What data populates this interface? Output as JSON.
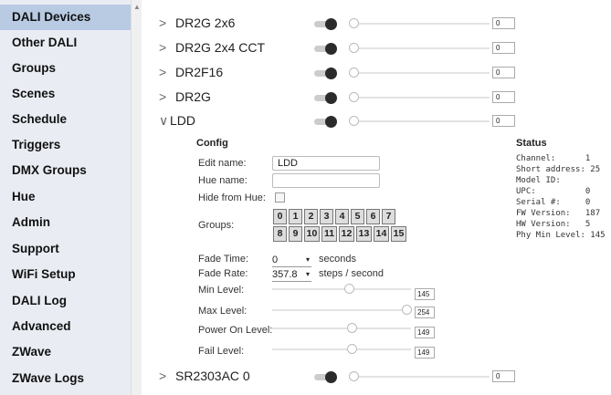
{
  "sidebar": {
    "items": [
      {
        "label": "DALI Devices",
        "active": true
      },
      {
        "label": "Other DALI"
      },
      {
        "label": "Groups"
      },
      {
        "label": "Scenes"
      },
      {
        "label": "Schedule"
      },
      {
        "label": "Triggers"
      },
      {
        "label": "DMX Groups"
      },
      {
        "label": "Hue"
      },
      {
        "label": "Admin"
      },
      {
        "label": "Support"
      },
      {
        "label": "WiFi Setup"
      },
      {
        "label": "DALI Log"
      },
      {
        "label": "Advanced"
      },
      {
        "label": "ZWave"
      },
      {
        "label": "ZWave Logs"
      }
    ]
  },
  "devices": [
    {
      "chevron": ">",
      "name": "DR2G 2x6",
      "value": "0"
    },
    {
      "chevron": ">",
      "name": "DR2G 2x4 CCT",
      "value": "0"
    },
    {
      "chevron": ">",
      "name": "DR2F16",
      "value": "0"
    },
    {
      "chevron": ">",
      "name": "DR2G",
      "value": "0"
    },
    {
      "chevron": "∨",
      "name": "LDD",
      "value": "0"
    },
    {
      "chevron": ">",
      "name": "SR2303AC 0",
      "value": "0"
    }
  ],
  "config": {
    "title": "Config",
    "edit_name_label": "Edit name:",
    "edit_name_value": "LDD",
    "hue_name_label": "Hue name:",
    "hue_name_value": "",
    "hide_from_hue_label": "Hide from Hue:",
    "groups_label": "Groups:",
    "groups_row1": [
      "0",
      "1",
      "2",
      "3",
      "4",
      "5",
      "6",
      "7"
    ],
    "groups_row2": [
      "8",
      "9",
      "10",
      "11",
      "12",
      "13",
      "14",
      "15"
    ],
    "fade_time_label": "Fade Time:",
    "fade_time_value": "0",
    "fade_time_unit": "seconds",
    "fade_rate_label": "Fade Rate:",
    "fade_rate_value": "357.8",
    "fade_rate_unit": "steps / second",
    "min_level_label": "Min Level:",
    "min_level_value": "145",
    "max_level_label": "Max Level:",
    "max_level_value": "254",
    "power_on_label": "Power On Level:",
    "power_on_value": "149",
    "fail_level_label": "Fail Level:",
    "fail_level_value": "149"
  },
  "status": {
    "title": "Status",
    "lines": [
      "Channel:      1",
      "Short address: 25",
      "Model ID:",
      "UPC:          0",
      "Serial #:     0",
      "FW Version:   187",
      "HW Version:   5",
      "Phy Min Level: 145"
    ]
  },
  "caret": "▾",
  "scroll_arrow": "▲"
}
